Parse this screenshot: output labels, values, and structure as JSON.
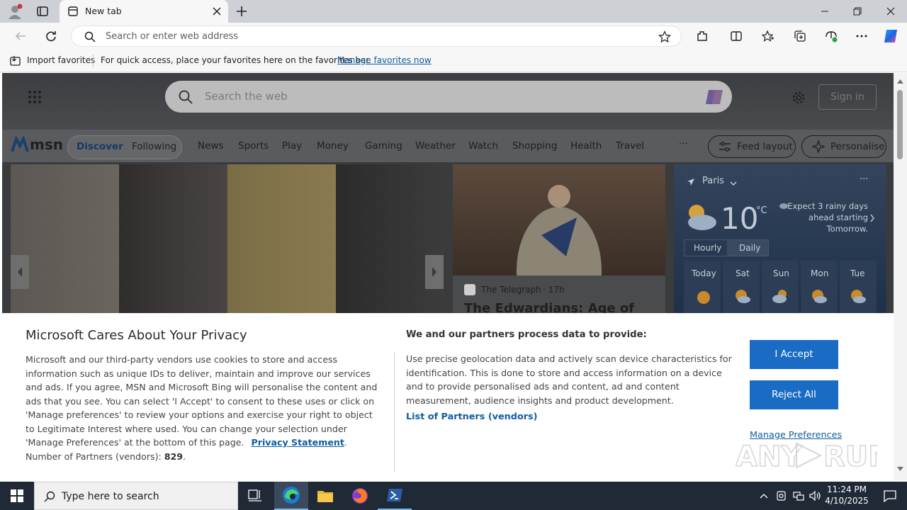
{
  "browser": {
    "tab_title": "New tab",
    "address_placeholder": "Search or enter web address",
    "favbar": {
      "import_label": "Import favorites",
      "hint": "For quick access, place your favorites here on the favorites bar.",
      "manage_link": "Manage favorites now"
    }
  },
  "msn": {
    "search_placeholder": "Search the web",
    "signin": "Sign in",
    "logo": "msn",
    "pill_tabs": [
      "Discover",
      "Following"
    ],
    "nav": [
      "News",
      "Sports",
      "Play",
      "Money",
      "Gaming",
      "Weather",
      "Watch",
      "Shopping",
      "Health",
      "Travel"
    ],
    "more": "···",
    "feed_layout": "Feed layout",
    "personalise": "Personalise",
    "news_source": "The Telegraph",
    "news_time": "· 17h",
    "news_headline": "The Edwardians: Age of",
    "weather": {
      "city": "Paris",
      "temp": "10",
      "unit": "°C",
      "forecast_text": "Expect 3 rainy days ahead starting Tomorrow.",
      "tabs": [
        "Hourly",
        "Daily"
      ],
      "days": [
        "Today",
        "Sat",
        "Sun",
        "Mon",
        "Tue"
      ],
      "more": "···"
    }
  },
  "privacy": {
    "title": "Microsoft Cares About Your Privacy",
    "body": "Microsoft and our third-party vendors use cookies to store and access information such as unique IDs to deliver, maintain and improve our services and ads. If you agree, MSN and Microsoft Bing will personalise the content and ads that you see. You can select 'I Accept' to consent to these uses or click on 'Manage preferences' to review your options and exercise your right to object to Legitimate Interest where used.  You can change your selection under 'Manage Preferences' at the bottom of this page.",
    "privacy_link": "Privacy Statement",
    "partners_label": "Number of Partners (vendors):",
    "partners_count": "829",
    "right_title": "We and our partners process data to provide:",
    "right_body": "Use precise geolocation data and actively scan device characteristics for identification. This is done to store and access information on a device and to provide personalised ads and content, ad and content measurement, audience insights and product development.",
    "partners_link": "List of Partners (vendors)",
    "accept": "I Accept",
    "reject": "Reject All",
    "manage": "Manage Preferences"
  },
  "taskbar": {
    "search_placeholder": "Type here to search",
    "time": "11:24 PM",
    "date": "4/10/2025"
  },
  "colors": {
    "accent": "#1a6bc4",
    "taskbar": "#1f2a36",
    "link": "#0f5c9e"
  }
}
